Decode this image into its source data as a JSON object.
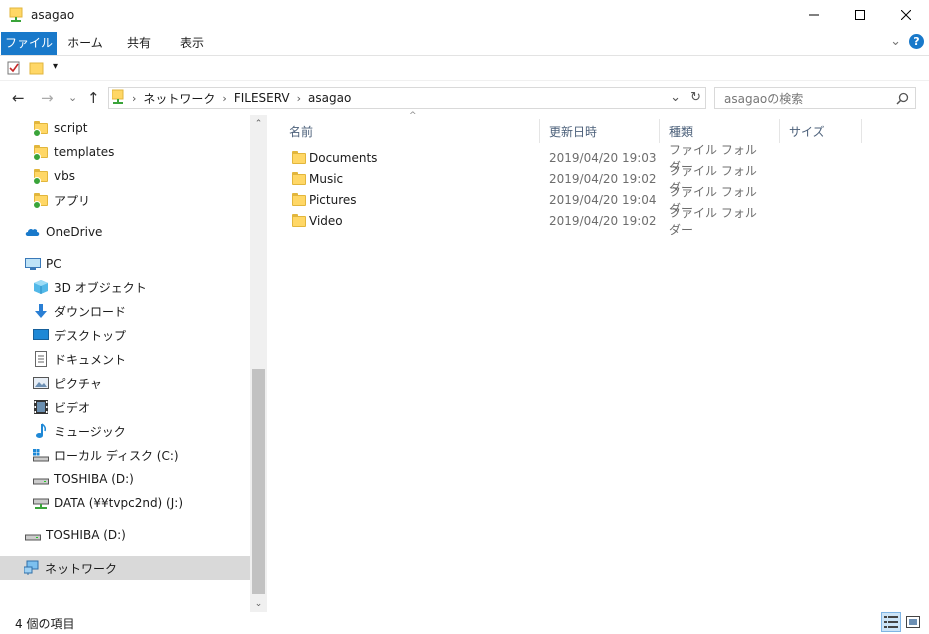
{
  "window": {
    "title": "asagao",
    "minimize_glyph": "─",
    "maximize_glyph": "☐",
    "close_glyph": "✕"
  },
  "ribbon": {
    "tabs": [
      "ファイル",
      "ホーム",
      "共有",
      "表示"
    ],
    "expand_glyph": "⌄",
    "help_glyph": "?"
  },
  "qat": {
    "dropdown_glyph": "▾"
  },
  "nav": {
    "back_glyph": "←",
    "forward_glyph": "→",
    "recent_glyph": "⌄",
    "up_glyph": "↑"
  },
  "address": {
    "crumbs": [
      "ネットワーク",
      "FILESERV",
      "asagao"
    ],
    "sep": "›",
    "dropdown_glyph": "⌄",
    "refresh_glyph": "↻"
  },
  "search": {
    "placeholder": "asagaoの検索",
    "icon_glyph": "⚲"
  },
  "navpane": {
    "items": [
      {
        "label": "script",
        "icon": "folder-sync-icon"
      },
      {
        "label": "templates",
        "icon": "folder-sync-icon"
      },
      {
        "label": "vbs",
        "icon": "folder-sync-icon"
      },
      {
        "label": "アプリ",
        "icon": "folder-sync-icon"
      },
      {
        "label": "OneDrive",
        "icon": "cloud-icon"
      },
      {
        "label": "PC",
        "icon": "pc-icon"
      },
      {
        "label": "3D オブジェクト",
        "icon": "cube-icon"
      },
      {
        "label": "ダウンロード",
        "icon": "download-icon"
      },
      {
        "label": "デスクトップ",
        "icon": "desktop-icon"
      },
      {
        "label": "ドキュメント",
        "icon": "document-icon"
      },
      {
        "label": "ピクチャ",
        "icon": "picture-icon"
      },
      {
        "label": "ビデオ",
        "icon": "video-icon"
      },
      {
        "label": "ミュージック",
        "icon": "music-icon"
      },
      {
        "label": "ローカル ディスク (C:)",
        "icon": "disk-icon"
      },
      {
        "label": "TOSHIBA (D:)",
        "icon": "drive-icon"
      },
      {
        "label": "DATA (¥¥tvpc2nd) (J:)",
        "icon": "network-drive-icon"
      },
      {
        "label": "TOSHIBA (D:)",
        "icon": "drive-icon"
      },
      {
        "label": "ネットワーク",
        "icon": "network-icon"
      }
    ],
    "scroll_up_glyph": "⌃",
    "scroll_down_glyph": "⌄"
  },
  "columns": {
    "name": "名前",
    "modified": "更新日時",
    "type": "種類",
    "size": "サイズ",
    "sort_glyph": "^"
  },
  "files": [
    {
      "name": "Documents",
      "modified": "2019/04/20 19:03",
      "type": "ファイル フォルダー"
    },
    {
      "name": "Music",
      "modified": "2019/04/20 19:02",
      "type": "ファイル フォルダー"
    },
    {
      "name": "Pictures",
      "modified": "2019/04/20 19:04",
      "type": "ファイル フォルダー"
    },
    {
      "name": "Video",
      "modified": "2019/04/20 19:02",
      "type": "ファイル フォルダー"
    }
  ],
  "status": {
    "item_count": "4 個の項目"
  },
  "colors": {
    "accent": "#1979ca",
    "selected_bg": "#d9d9d9",
    "header_text": "#4c607a"
  }
}
